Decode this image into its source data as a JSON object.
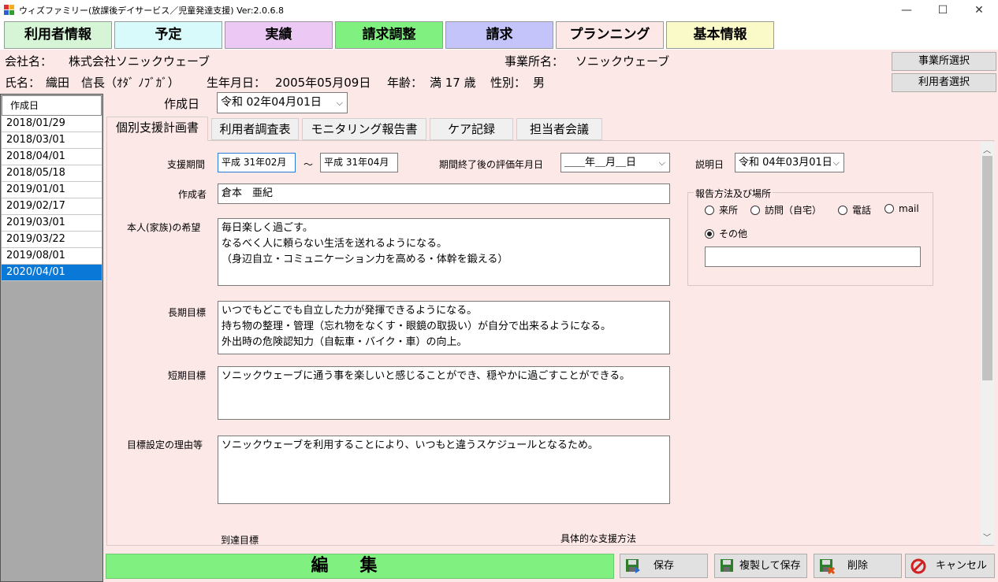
{
  "window": {
    "title": "ウィズファミリー(放課後デイサービス／児童発達支援) Ver:2.0.6.8",
    "minimize": "—",
    "maximize": "☐",
    "close": "✕"
  },
  "menu": [
    {
      "label": "利用者情報",
      "color": "#d6f5d6"
    },
    {
      "label": "予定",
      "color": "#d8fafa"
    },
    {
      "label": "実績",
      "color": "#ecc8f5"
    },
    {
      "label": "請求調整",
      "color": "#80f080"
    },
    {
      "label": "請求",
      "color": "#c4c4fa"
    },
    {
      "label": "プランニング",
      "color": "#fde8e8"
    },
    {
      "label": "基本情報",
      "color": "#fafac8"
    }
  ],
  "info": {
    "company_label": "会社名：",
    "company": "株式会社ソニックウェーブ",
    "office_label": "事業所名：",
    "office": "ソニックウェーブ",
    "name_label": "氏名：",
    "name": "織田　信長（ｵﾀﾞ ﾉﾌﾞｶﾞ）",
    "birth_label": "生年月日：",
    "birth": "2005年05月09日",
    "age_label": "年齢：",
    "age": "満 17 歳",
    "gender_label": "性別：",
    "gender": "男",
    "office_select": "事業所選択",
    "user_select": "利用者選択"
  },
  "datelist": {
    "header": "作成日",
    "dates": [
      "2018/01/29",
      "2018/03/01",
      "2018/04/01",
      "2018/05/18",
      "2019/01/01",
      "2019/02/17",
      "2019/03/01",
      "2019/03/22",
      "2019/08/01",
      "2020/04/01"
    ],
    "selected_index": 9
  },
  "created": {
    "label": "作成日",
    "value": "令和 02年04月01日"
  },
  "tabs": [
    "個別支援計画書",
    "利用者調査表",
    "モニタリング報告書",
    "ケア記録",
    "担当者会議"
  ],
  "form": {
    "period_label": "支援期間",
    "period_from": "平成 31年02月",
    "period_sep": "～",
    "period_to": "平成 31年04月",
    "eval_label": "期間終了後の評価年月日",
    "eval_value": "＿＿年＿月＿日",
    "explain_label": "説明日",
    "explain_value": "令和 04年03月01日",
    "author_label": "作成者",
    "author": "倉本　亜紀",
    "wish_label": "本人(家族)の希望",
    "wish_lines": [
      "毎日楽しく過ごす。",
      "なるべく人に頼らない生活を送れるようになる。",
      "（身辺自立・コミュニケーション力を高める・体幹を鍛える）"
    ],
    "long_label": "長期目標",
    "long_lines": [
      "いつでもどこでも自立した力が発揮できるようになる。",
      "持ち物の整理・管理（忘れ物をなくす・眼鏡の取扱い）が自分で出来るようになる。",
      "外出時の危険認知力（自転車・バイク・車）の向上。"
    ],
    "short_label": "短期目標",
    "short_lines": [
      "ソニックウェーブに通う事を楽しいと感じることができ、穏やかに過ごすことができる。"
    ],
    "reason_label": "目標設定の理由等",
    "reason_lines": [
      "ソニックウェーブを利用することにより、いつもと違うスケジュールとなるため。"
    ],
    "goal_label": "到達目標",
    "method_label": "具体的な支援方法",
    "report": {
      "legend": "報告方法及び場所",
      "options": [
        "来所",
        "訪問（自宅）",
        "電話",
        "mail"
      ],
      "other": "その他",
      "other_value": ""
    }
  },
  "bottom": {
    "edit": "編集",
    "save": "保存",
    "copy_save": "複製して保存",
    "delete": "削除",
    "cancel": "キャンセル"
  }
}
